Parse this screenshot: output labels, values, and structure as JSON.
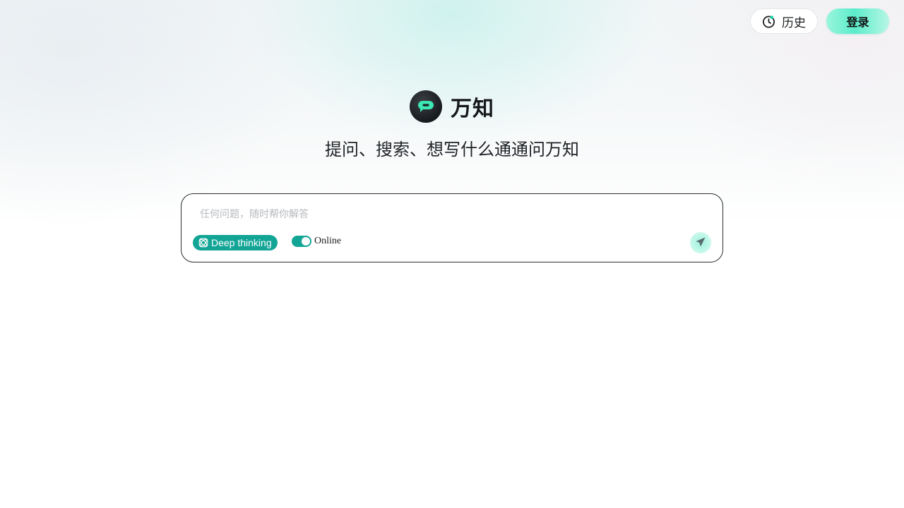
{
  "header": {
    "history_label": "历史",
    "login_label": "登录"
  },
  "brand": {
    "name": "万知",
    "tagline": "提问、搜索、想写什么通通问万知"
  },
  "composer": {
    "placeholder": "任何问题，随时帮你解答",
    "value": "",
    "deep_thinking_label": "Deep thinking",
    "online_label": "Online",
    "online_enabled": true
  },
  "icons": {
    "history": "history-clock-icon",
    "deep_thinking": "atom-icon",
    "send": "send-arrow-icon",
    "logo": "chat-bubble-logo"
  },
  "colors": {
    "accent": "#12a596",
    "login_gradient_start": "#9af5dc",
    "login_gradient_mid": "#5ceccb",
    "logo_bg": "#1c1f23",
    "logo_mark": "#3de8b3"
  }
}
